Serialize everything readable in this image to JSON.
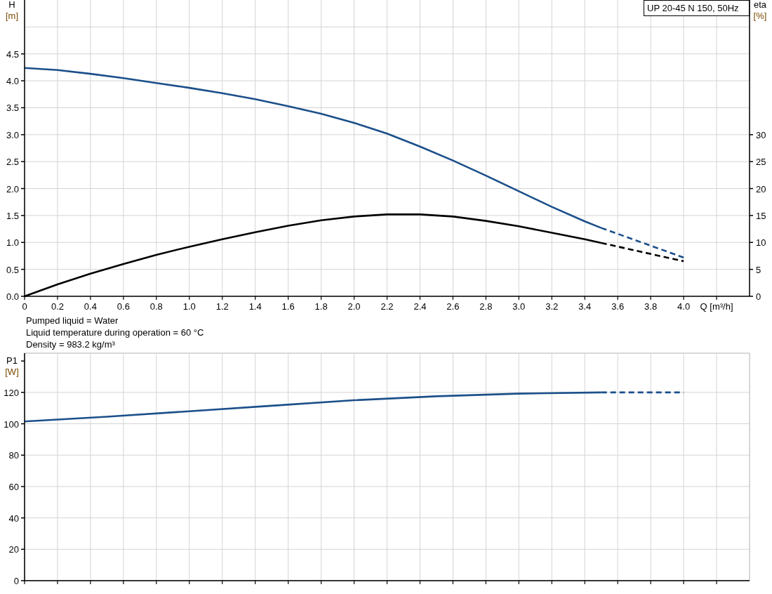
{
  "charts": [
    {
      "chart_data": {
        "type": "line",
        "title": "UP 20-45 N 150, 50Hz",
        "xlabel": "Q [m³/h]",
        "ylabel": "H [m]",
        "y2label": "eta [%]",
        "grid": true,
        "x": [
          0,
          0.2,
          0.4,
          0.6,
          0.8,
          1.0,
          1.2,
          1.4,
          1.6,
          1.8,
          2.0,
          2.2,
          2.4,
          2.6,
          2.8,
          3.0,
          3.2,
          3.4,
          3.5,
          4.0
        ],
        "series": [
          {
            "color": "#1b4f8a",
            "values": [
              4.24,
              4.2,
              4.13,
              4.05,
              3.96,
              3.87,
              3.77,
              3.66,
              3.53,
              3.39,
              3.22,
              3.02,
              2.78,
              2.52,
              2.24,
              1.95,
              1.66,
              1.39,
              1.27,
              null
            ]
          },
          {
            "color": "#1b4f8a",
            "line_style": "dashed",
            "values": [
              null,
              null,
              null,
              null,
              null,
              null,
              null,
              null,
              null,
              null,
              null,
              null,
              null,
              null,
              null,
              null,
              null,
              null,
              1.27,
              0.72
            ]
          },
          {
            "color": "#000000",
            "axis": "y2",
            "values": [
              0,
              2.2,
              4.2,
              6.0,
              7.7,
              9.2,
              10.6,
              11.9,
              13.1,
              14.1,
              14.8,
              15.2,
              15.2,
              14.8,
              14.0,
              13.0,
              11.8,
              10.6,
              9.9,
              null
            ]
          },
          {
            "color": "#000000",
            "axis": "y2",
            "line_style": "dashed",
            "values": [
              null,
              null,
              null,
              null,
              null,
              null,
              null,
              null,
              null,
              null,
              null,
              null,
              null,
              null,
              null,
              null,
              null,
              null,
              9.9,
              6.5
            ]
          }
        ],
        "xlim": [
          0,
          4.4
        ],
        "ylim": [
          0,
          5.5
        ],
        "y2lim": [
          0,
          55
        ],
        "xticks": [
          {
            "value": 0,
            "label": "0"
          },
          {
            "value": 0.2,
            "label": "0.2"
          },
          {
            "value": 0.4,
            "label": "0.4"
          },
          {
            "value": 0.6,
            "label": "0.6"
          },
          {
            "value": 0.8,
            "label": "0.8"
          },
          {
            "value": 1.0,
            "label": "1.0"
          },
          {
            "value": 1.2,
            "label": "1.2"
          },
          {
            "value": 1.4,
            "label": "1.4"
          },
          {
            "value": 1.6,
            "label": "1.6"
          },
          {
            "value": 1.8,
            "label": "1.8"
          },
          {
            "value": 2.0,
            "label": "2.0"
          },
          {
            "value": 2.2,
            "label": "2.2"
          },
          {
            "value": 2.4,
            "label": "2.4"
          },
          {
            "value": 2.6,
            "label": "2.6"
          },
          {
            "value": 2.8,
            "label": "2.8"
          },
          {
            "value": 3.0,
            "label": "3.0"
          },
          {
            "value": 3.2,
            "label": "3.2"
          },
          {
            "value": 3.4,
            "label": "3.4"
          },
          {
            "value": 3.6,
            "label": "3.6"
          },
          {
            "value": 3.8,
            "label": "3.8"
          },
          {
            "value": 4.0,
            "label": "4.0"
          }
        ],
        "yticks": [
          {
            "value": 0,
            "label": "0.0"
          },
          {
            "value": 0.5,
            "label": "0.5"
          },
          {
            "value": 1.0,
            "label": "1.0"
          },
          {
            "value": 1.5,
            "label": "1.5"
          },
          {
            "value": 2.0,
            "label": "2.0"
          },
          {
            "value": 2.5,
            "label": "2.5"
          },
          {
            "value": 3.0,
            "label": "3.0"
          },
          {
            "value": 3.5,
            "label": "3.5"
          },
          {
            "value": 4.0,
            "label": "4.0"
          },
          {
            "value": 4.5,
            "label": "4.5"
          }
        ],
        "y2ticks": [
          0,
          5,
          10,
          15,
          20,
          25,
          30
        ]
      }
    },
    {
      "notes": [
        "Pumped liquid = Water",
        "Liquid temperature during operation = 60 °C",
        "Density = 983.2 kg/m³"
      ]
    },
    {
      "chart_data": {
        "type": "line",
        "ylabel": "P1 [W]",
        "grid": true,
        "x": [
          0,
          0.5,
          1.0,
          1.5,
          2.0,
          2.5,
          3.0,
          3.5,
          4.0
        ],
        "series": [
          {
            "color": "#1b4f8a",
            "values": [
              101.5,
              104.5,
              108,
              111.5,
              115,
              117.5,
              119.2,
              120,
              null
            ]
          },
          {
            "color": "#1b4f8a",
            "line_style": "dashed",
            "values": [
              null,
              null,
              null,
              null,
              null,
              null,
              null,
              120,
              120
            ]
          }
        ],
        "xlim": [
          0,
          4.4
        ],
        "ylim": [
          0,
          145
        ],
        "yticks": [
          0,
          20,
          40,
          60,
          80,
          100,
          120
        ]
      }
    }
  ]
}
